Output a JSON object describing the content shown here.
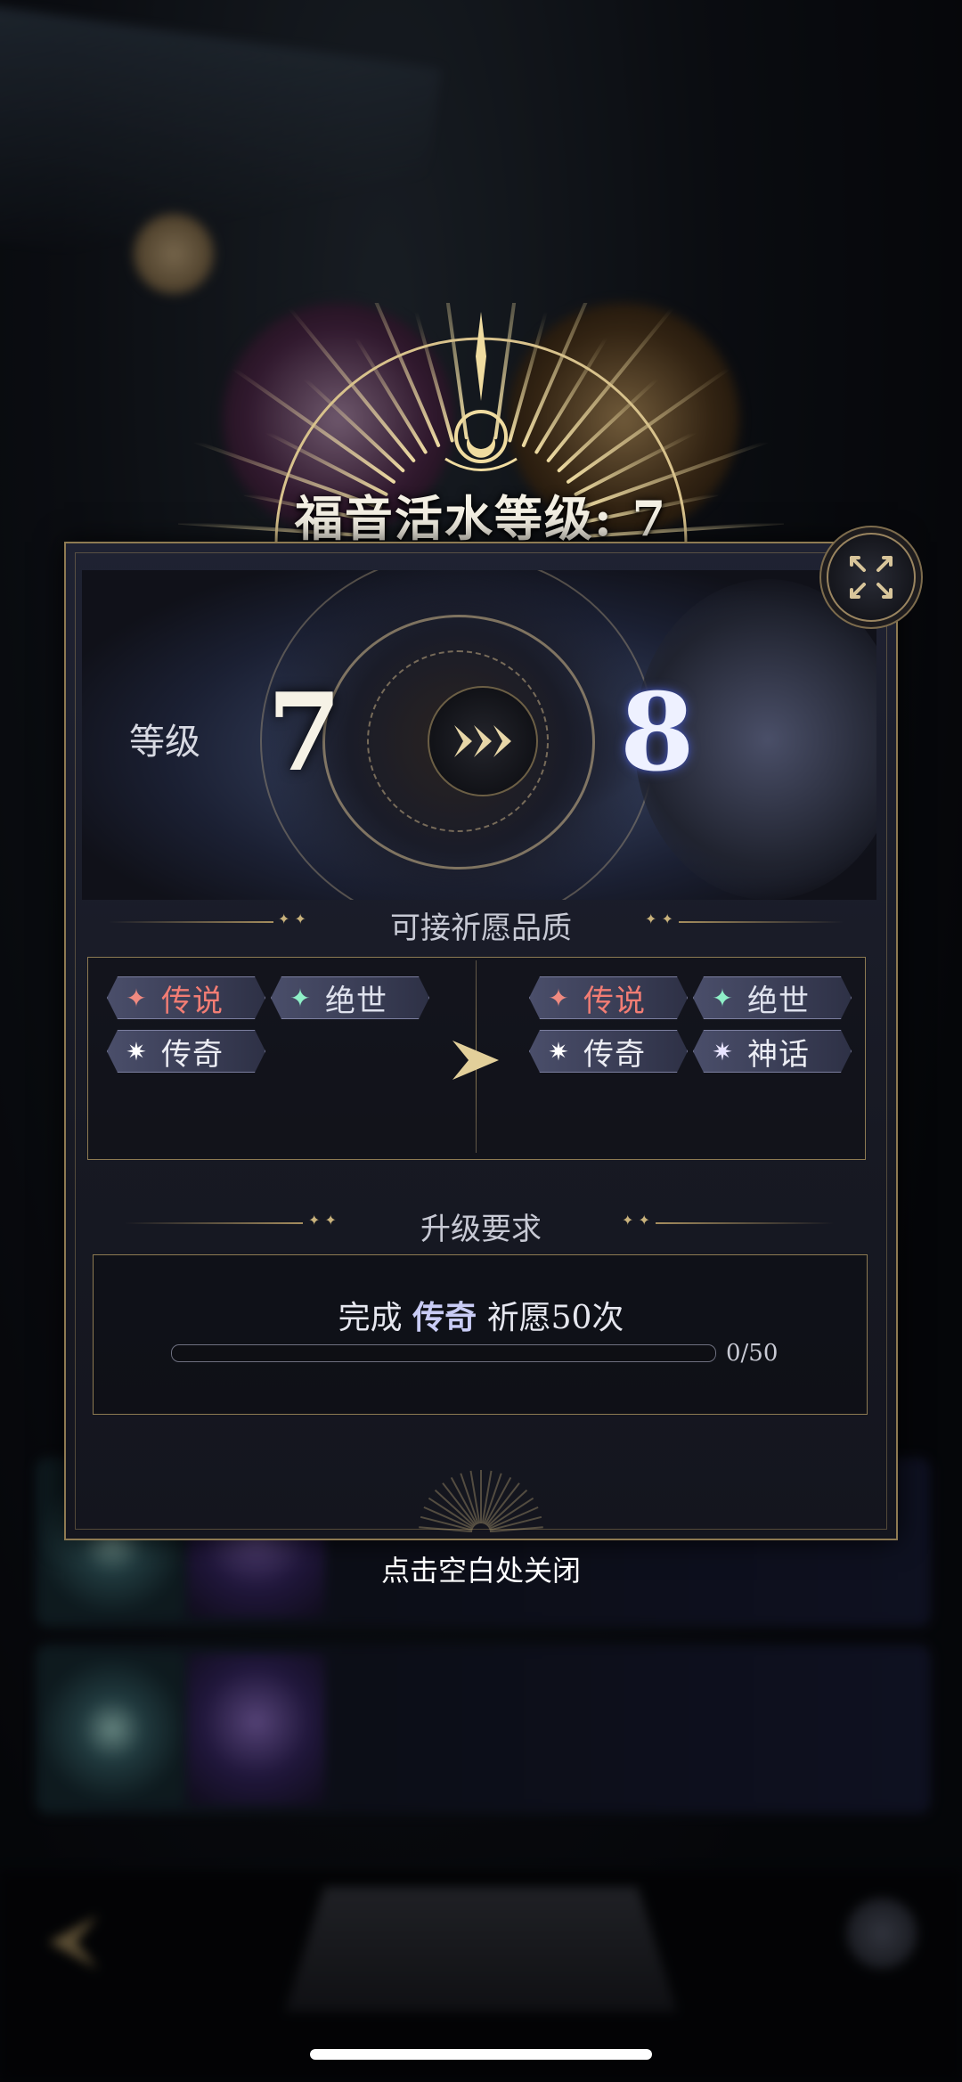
{
  "background": {
    "cards": [
      {
        "title": "",
        "subtitle": "",
        "button": ""
      },
      {
        "title": "",
        "subtitle": "",
        "button": ""
      }
    ],
    "hint": "",
    "bottom_button": ""
  },
  "dialog": {
    "title": "福音活水等级: 7",
    "level_label": "等级",
    "level_from": "7",
    "level_to": "8",
    "quality_section_title": "可接祈愿品质",
    "current_qualities": [
      {
        "label": "传说",
        "type": "legend",
        "icon": "four-point-star-icon"
      },
      {
        "label": "绝世",
        "type": "peerless",
        "icon": "four-point-star-icon"
      },
      {
        "label": "传奇",
        "type": "myth",
        "icon": "eight-point-star-icon"
      }
    ],
    "next_qualities": [
      {
        "label": "传说",
        "type": "legend",
        "icon": "four-point-star-icon"
      },
      {
        "label": "绝世",
        "type": "peerless",
        "icon": "four-point-star-icon"
      },
      {
        "label": "传奇",
        "type": "myth",
        "icon": "eight-point-star-icon"
      },
      {
        "label": "神话",
        "type": "divine",
        "icon": "eight-point-star-icon"
      }
    ],
    "requirement_section_title": "升级要求",
    "requirement": {
      "prefix": "完成",
      "highlight": "传奇",
      "suffix": "祈愿50次",
      "progress_text": "0/50",
      "progress_fraction": 0
    },
    "close_hint": "点击空白处关闭"
  },
  "colors": {
    "gold": "#a58d5e",
    "legend_red": "#f27d74",
    "peerless_teal": "#8ff0c8",
    "level_to_glow": "#4a5ab8"
  }
}
